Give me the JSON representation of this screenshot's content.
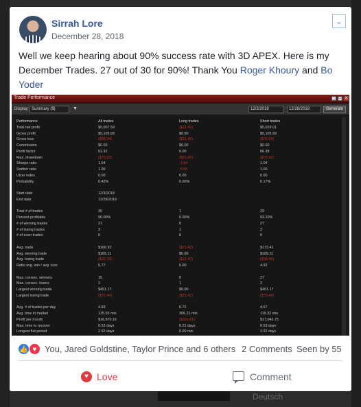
{
  "post": {
    "author": "Sirrah Lore",
    "date": "December 28, 2018",
    "text_before": "Well we keep hearing about 90% success rate with 3D APEX. Here is my December Trades. 27 out of 30 for 90%! Thank You ",
    "mention1": "Roger Khoury",
    "text_and": " and ",
    "mention2": "Bo Yoder",
    "menu_icon": "chevron-down-icon"
  },
  "trade_performance": {
    "window_title": "Trade Performance",
    "display_label": "Display",
    "display_value": "Summary ($)",
    "date_from": "12/3/2018",
    "date_to": "12/28/2018",
    "generate_label": "Generate",
    "headers": [
      "Performance",
      "All trades",
      "Long trades",
      "Short trades"
    ],
    "rows": [
      [
        "Total net profit",
        "$5,007.59",
        "($21.42)",
        "$5,029.01"
      ],
      [
        "Gross profit",
        "$5,105.93",
        "$0.00",
        "$5,105.93"
      ],
      [
        "Gross loss",
        "($98.34)",
        "($21.42)",
        "($76.92)"
      ],
      [
        "Commission",
        "$0.00",
        "$0.00",
        "$0.00"
      ],
      [
        "Profit factor",
        "51.92",
        "0.00",
        "66.38"
      ],
      [
        "Max. drawdown",
        "($79.62)",
        "($21.42)",
        "($76.92)"
      ],
      [
        "Sharpe ratio",
        "1.04",
        "-1.64",
        "1.04"
      ],
      [
        "Sortino ratio",
        "1.00",
        "-0.06",
        "1.00"
      ],
      [
        "Ulcer index",
        "0.00",
        "0.00",
        "0.00"
      ],
      [
        "Probability",
        "0.42%",
        "0.00%",
        "0.17%"
      ],
      [
        "",
        "",
        "",
        ""
      ],
      [
        "Start date",
        "12/3/2018",
        "",
        ""
      ],
      [
        "End date",
        "12/28/2018",
        "",
        ""
      ],
      [
        "",
        "",
        "",
        ""
      ],
      [
        "Total # of trades",
        "30",
        "1",
        "29"
      ],
      [
        "Percent profitable",
        "90.00%",
        "0.00%",
        "93.10%"
      ],
      [
        "# of winning trades",
        "27",
        "0",
        "27"
      ],
      [
        "# of losing trades",
        "3",
        "1",
        "2"
      ],
      [
        "# of even trades",
        "0",
        "0",
        "0"
      ],
      [
        "",
        "",
        "",
        ""
      ],
      [
        "Avg. trade",
        "$166.92",
        "($21.42)",
        "$173.41"
      ],
      [
        "Avg. winning trade",
        "$189.11",
        "$0.00",
        "$189.11"
      ],
      [
        "Avg. losing trade",
        "($32.78)",
        "($21.42)",
        "($38.46)"
      ],
      [
        "Ratio avg. win / avg. loss",
        "5.77",
        "0.00",
        "4.92"
      ],
      [
        "",
        "",
        "",
        ""
      ],
      [
        "Max. consec. winners",
        "15",
        "0",
        "27"
      ],
      [
        "Max. consec. losers",
        "2",
        "1",
        "2"
      ],
      [
        "Largest winning trade",
        "$451.17",
        "$0.00",
        "$451.17"
      ],
      [
        "Largest losing trade",
        "($75.44)",
        "($21.42)",
        "($75.44)"
      ],
      [
        "",
        "",
        "",
        ""
      ],
      [
        "Avg. # of trades per day",
        "4.83",
        "0.72",
        "4.67"
      ],
      [
        "Avg. time in market",
        "125.55 min",
        "306.21 min",
        "119.32 min"
      ],
      [
        "Profit per month",
        "$16,970.16",
        "($325.61)",
        "$17,042.75"
      ],
      [
        "Max. time to recover",
        "0.53 days",
        "0.21 days",
        "0.53 days"
      ],
      [
        "Longest flat period",
        "2.92 days",
        "0.00 min",
        "2.92 days"
      ]
    ]
  },
  "reactions": {
    "like_icon": "like-icon",
    "heart_icon": "heart-icon",
    "summary": "You, Jared Goldstine, Taylor Prince and 6 others",
    "comments": "2 Comments",
    "seen": "Seen by 55"
  },
  "actions": {
    "love_label": "Love",
    "comment_label": "Comment",
    "love_color": "#e0393e"
  },
  "background": {
    "partial_text": "Deutsch"
  },
  "colors": {
    "link": "#365899",
    "negative": "#c0392b",
    "titlebar": "#7d1a16"
  }
}
